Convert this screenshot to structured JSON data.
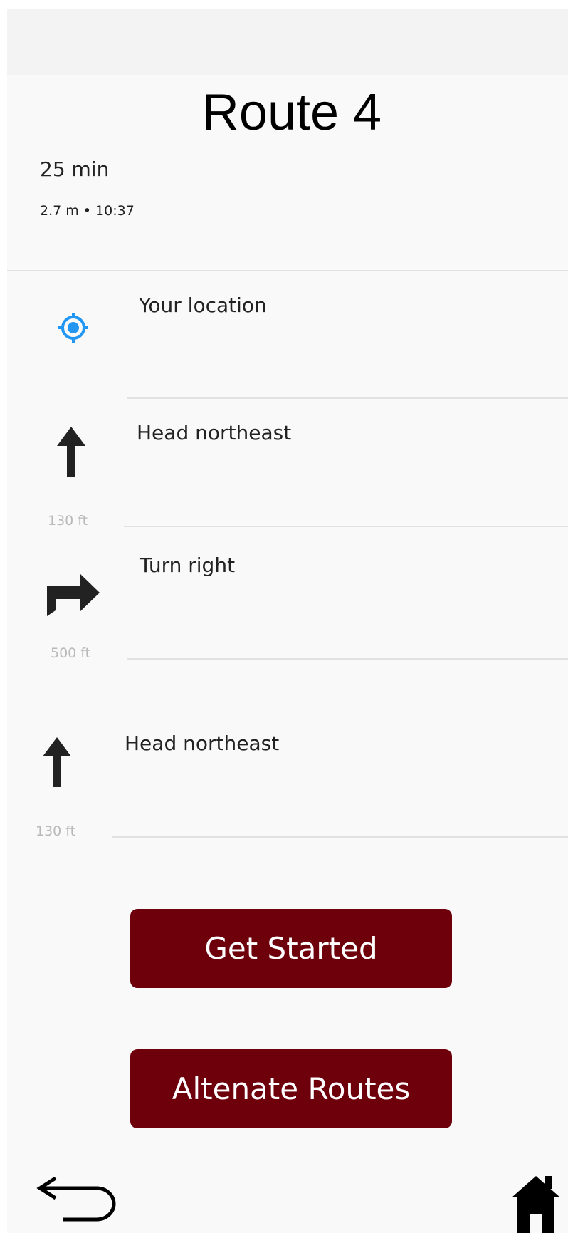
{
  "header": {
    "title": "Route 4",
    "duration": "25 min",
    "summary": "2.7 m • 10:37"
  },
  "steps": [
    {
      "icon": "my-location-icon",
      "label": "Your location",
      "distance": ""
    },
    {
      "icon": "arrow-up-icon",
      "label": "Head northeast",
      "distance": "130 ft"
    },
    {
      "icon": "turn-right-icon",
      "label": "Turn right",
      "distance": "500 ft"
    },
    {
      "icon": "arrow-up-icon",
      "label": "Head northeast",
      "distance": "130 ft"
    }
  ],
  "actions": {
    "get_started": "Get Started",
    "alternate_routes": "Altenate Routes"
  },
  "nav": {
    "back_icon": "back-arrow-icon",
    "home_icon": "home-icon"
  },
  "colors": {
    "button": "#6d000b",
    "location_icon": "#2196f3",
    "distance_text": "#b9b9b9"
  }
}
